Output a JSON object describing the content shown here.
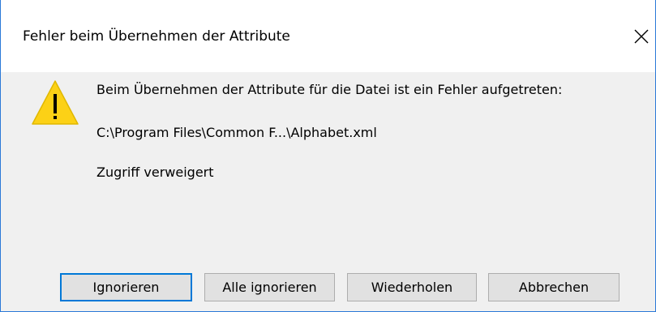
{
  "dialog": {
    "title": "Fehler beim Übernehmen der Attribute",
    "close_icon": "close-icon",
    "warning_icon": "warning-triangle-icon",
    "message": "Beim Übernehmen der Attribute für die Datei ist ein Fehler aufgetreten:",
    "file_path": "C:\\Program Files\\Common F...\\Alphabet.xml",
    "error_text": "Zugriff verweigert",
    "accent_color": "#0078d7",
    "warning_color": "#fcd116"
  },
  "buttons": {
    "ignore": "Ignorieren",
    "ignore_all": "Alle ignorieren",
    "retry": "Wiederholen",
    "cancel": "Abbrechen"
  }
}
